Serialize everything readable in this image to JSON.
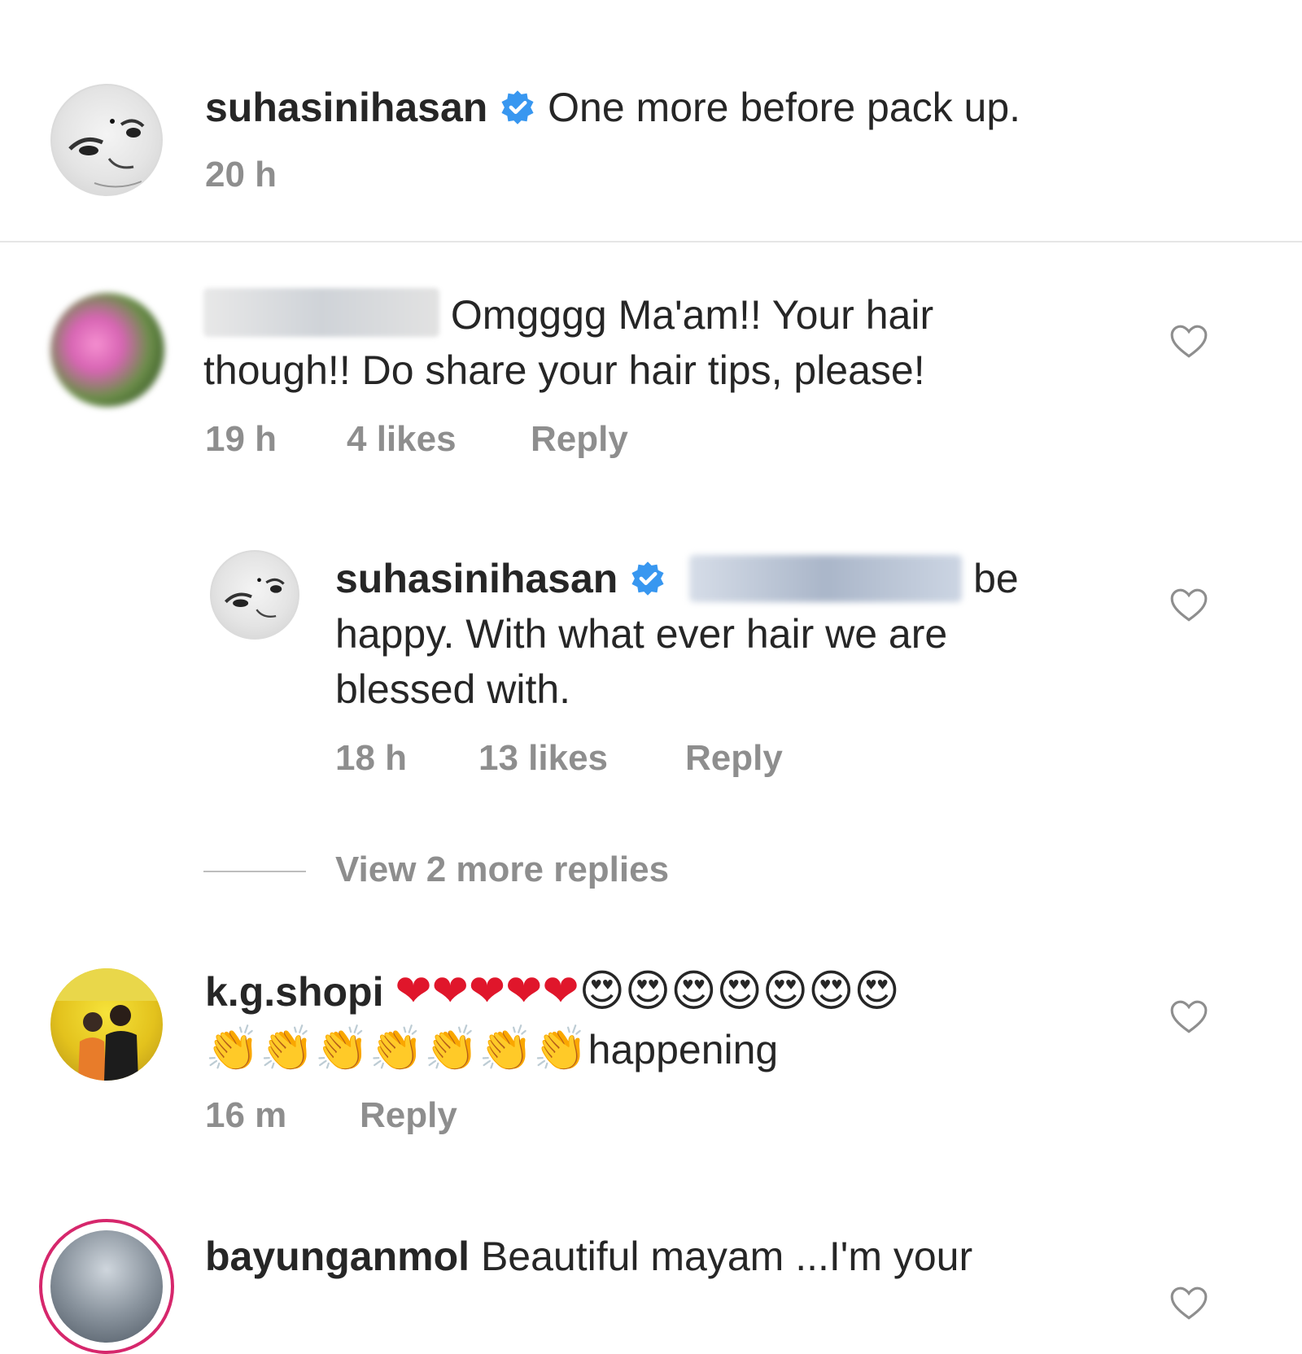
{
  "post_caption": {
    "username": "suhasinihasan",
    "text": "One more before pack up.",
    "time": "20 h"
  },
  "comments": [
    {
      "text_line1": "Omgggg Ma'am!! Your hair",
      "text_line2": "though!! Do share your hair tips, please!",
      "time": "19 h",
      "likes": "4 likes",
      "reply_label": "Reply"
    },
    {
      "username": "suhasinihasan",
      "text_line1_end": "be",
      "text_line2": "happy.  With what ever hair we are",
      "text_line3": "blessed with.",
      "time": "18 h",
      "likes": "13 likes",
      "reply_label": "Reply"
    },
    {
      "view_more": "View 2 more replies"
    },
    {
      "username": "k.g.shopi",
      "hearts": "❤❤❤❤❤",
      "heart_eyes": "😍😍😍😍😍😍😍",
      "claps": "👏👏👏👏👏👏👏",
      "text_end": "happening",
      "time": "16 m",
      "reply_label": "Reply"
    },
    {
      "username": "bayunganmol",
      "text": "Beautiful mayam ...I'm  your"
    }
  ],
  "colors": {
    "verified_blue": "#3897f0",
    "meta_gray": "#8e8e8e",
    "text": "#262626",
    "heart_red": "#e0162b"
  }
}
